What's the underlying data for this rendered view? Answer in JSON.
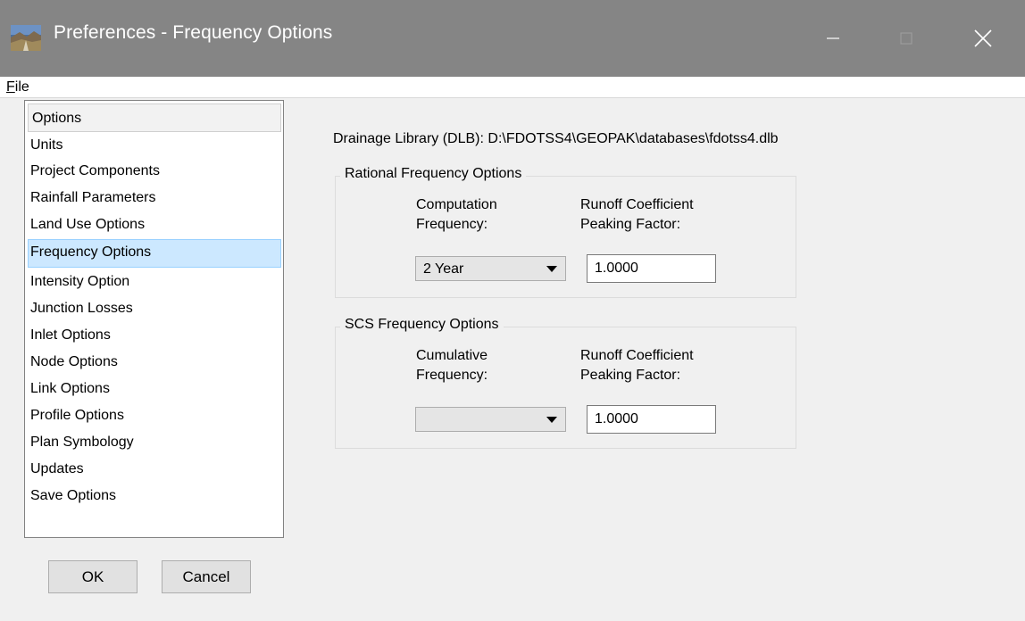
{
  "window": {
    "title": "Preferences - Frequency Options",
    "icon": "app-landscape-icon",
    "controls": [
      "minimize-icon",
      "maximize-icon",
      "close-icon"
    ]
  },
  "menu": {
    "file_mnemonic": "F",
    "file_rest": "ile"
  },
  "sidebar": {
    "header": "Options",
    "selected_index": 4,
    "items": [
      {
        "label": "Units"
      },
      {
        "label": "Project Components"
      },
      {
        "label": "Rainfall Parameters"
      },
      {
        "label": "Land Use Options"
      },
      {
        "label": "Frequency Options"
      },
      {
        "label": "Intensity Option"
      },
      {
        "label": "Junction Losses"
      },
      {
        "label": "Inlet Options"
      },
      {
        "label": "Node Options"
      },
      {
        "label": "Link Options"
      },
      {
        "label": "Profile Options"
      },
      {
        "label": "Plan Symbology"
      },
      {
        "label": "Updates"
      },
      {
        "label": "Save Options"
      }
    ]
  },
  "buttons": {
    "ok": "OK",
    "cancel": "Cancel"
  },
  "main": {
    "dlb_label": "Drainage Library (DLB): D:\\FDOTSS4\\GEOPAK\\databases\\fdotss4.dlb",
    "rational": {
      "title": "Rational Frequency Options",
      "left_label_1": "Computation",
      "left_label_2": "Frequency:",
      "right_label_1": "Runoff Coefficient",
      "right_label_2": "Peaking Factor:",
      "frequency_value": "2 Year",
      "peaking_factor": "1.0000"
    },
    "scs": {
      "title": "SCS Frequency Options",
      "left_label_1": "Cumulative",
      "left_label_2": "Frequency:",
      "right_label_1": "Runoff Coefficient",
      "right_label_2": "Peaking Factor:",
      "frequency_value": "",
      "peaking_factor": "1.0000"
    }
  },
  "colors": {
    "titlebar": "#858585",
    "selection": "#cce8ff",
    "selection_border": "#99d1ff",
    "window_bg": "#f0f0f0"
  }
}
